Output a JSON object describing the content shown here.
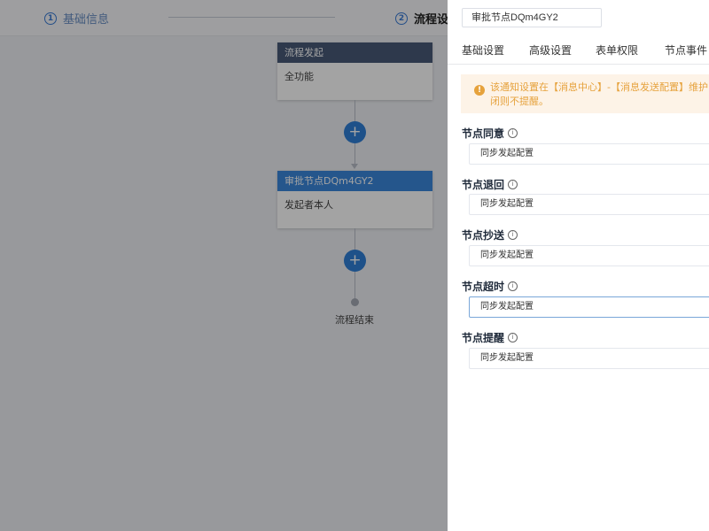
{
  "steps": {
    "step1": {
      "num": "1",
      "label": "基础信息"
    },
    "step2": {
      "num": "2",
      "label": "流程设"
    }
  },
  "flow": {
    "start_node": {
      "title": "流程发起",
      "body": "全功能"
    },
    "approve_node": {
      "title": "审批节点DQm4GY2",
      "body": "发起者本人"
    },
    "add_symbol": "+",
    "end_label": "流程结束"
  },
  "drawer": {
    "title_value": "审批节点DQm4GY2",
    "tabs": [
      "基础设置",
      "高级设置",
      "表单权限",
      "节点事件"
    ],
    "notice": {
      "icon": "!",
      "line1": "该通知设置在【消息中心】-【消息发送配置】维护，选",
      "line2": "闭则不提醒。"
    },
    "sections": [
      {
        "label": "节点同意",
        "value": "同步发起配置"
      },
      {
        "label": "节点退回",
        "value": "同步发起配置"
      },
      {
        "label": "节点抄送",
        "value": "同步发起配置"
      },
      {
        "label": "节点超时",
        "value": "同步发起配置"
      },
      {
        "label": "节点提醒",
        "value": "同步发起配置"
      }
    ]
  },
  "icons": {
    "info": "i"
  },
  "colors": {
    "accent": "#2f7fd6",
    "warning": "#e6a23c",
    "start_header": "#485a78"
  }
}
